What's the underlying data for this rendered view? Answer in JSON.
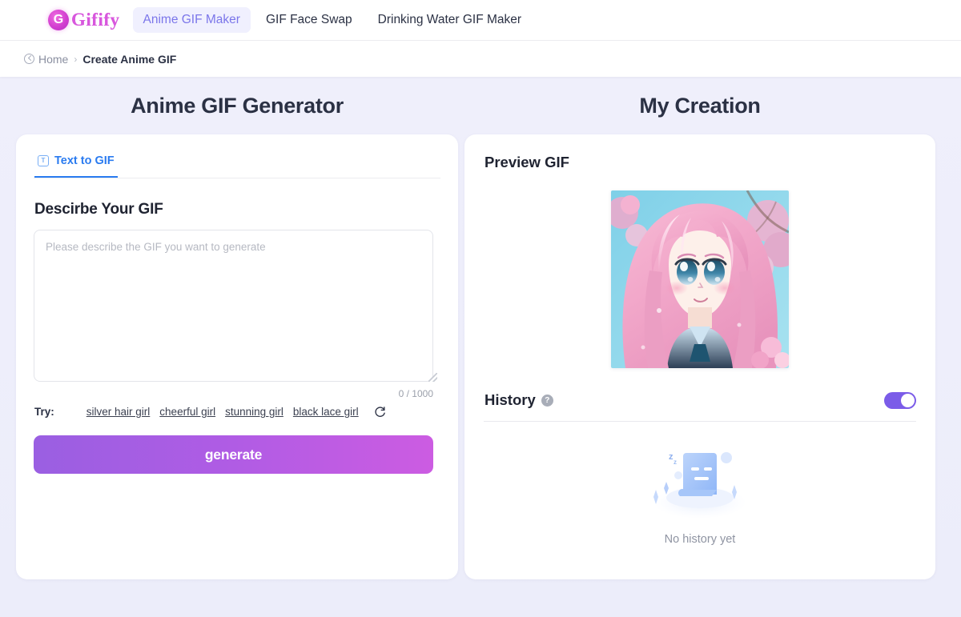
{
  "brand": {
    "name": "Gifify",
    "mark_letter": "G",
    "mark_icon": "gifify-logo-icon"
  },
  "nav": {
    "items": [
      {
        "label": "Anime GIF Maker",
        "active": true
      },
      {
        "label": "GIF Face Swap",
        "active": false
      },
      {
        "label": "Drinking Water GIF Maker",
        "active": false
      }
    ]
  },
  "breadcrumb": {
    "home_icon": "clock-back-icon",
    "home": "Home",
    "separator": "›",
    "current": "Create Anime GIF"
  },
  "left": {
    "heading": "Anime GIF Generator",
    "tab": {
      "icon": "text-box-icon",
      "icon_letter": "T",
      "label": "Text to GIF"
    },
    "section_title": "Descirbe Your GIF",
    "prompt": {
      "value": "",
      "placeholder": "Please describe the GIF you want to generate"
    },
    "counter": "0 / 1000",
    "try": {
      "label": "Try:",
      "suggestions": [
        "silver hair girl",
        "cheerful girl",
        "stunning girl",
        "black lace girl"
      ],
      "refresh_icon": "refresh-icon"
    },
    "generate_label": "generate"
  },
  "right": {
    "heading": "My Creation",
    "preview_title": "Preview GIF",
    "preview_image": "anime-girl-pink-hair-cherry-blossom",
    "history": {
      "title": "History",
      "help_icon": "question-mark-icon",
      "help_label": "?",
      "toggle_on": true,
      "empty_icon": "sleeping-document-icon",
      "empty_text": "No history yet",
      "sleep_label": "Zz"
    }
  },
  "colors": {
    "page_bg": "#ececf8",
    "accent_purple": "#7b5ce8",
    "nav_active_bg": "#f0f0fe",
    "nav_active_text": "#7b76ea",
    "tab_blue": "#2a7bf0",
    "generate_gradient_from": "#9a5fe2",
    "generate_gradient_to": "#cc5ce2",
    "brand_pink": "#d857dd"
  }
}
